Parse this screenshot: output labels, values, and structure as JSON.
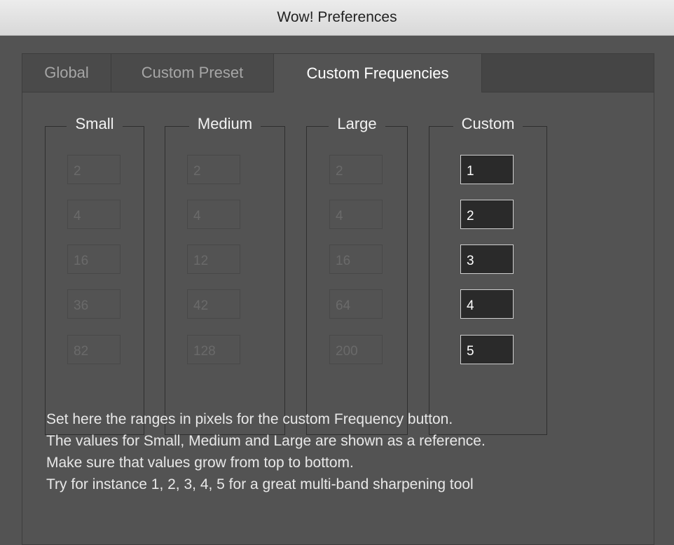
{
  "window": {
    "title": "Wow! Preferences"
  },
  "tabs": [
    {
      "label": "Global"
    },
    {
      "label": "Custom Preset"
    },
    {
      "label": "Custom Frequencies"
    }
  ],
  "groups": {
    "small": {
      "label": "Small",
      "values": [
        "2",
        "4",
        "16",
        "36",
        "82"
      ]
    },
    "medium": {
      "label": "Medium",
      "values": [
        "2",
        "4",
        "12",
        "42",
        "128"
      ]
    },
    "large": {
      "label": "Large",
      "values": [
        "2",
        "4",
        "16",
        "64",
        "200"
      ]
    },
    "custom": {
      "label": "Custom",
      "values": [
        "1",
        "2",
        "3",
        "4",
        "5"
      ]
    }
  },
  "help": {
    "lines": [
      "Set here the ranges in pixels for the custom Frequency button.",
      "The values for Small, Medium and Large are shown as a reference.",
      "Make sure that values grow from top to bottom.",
      "Try for instance 1, 2, 3, 4, 5 for a great multi-band sharpening tool"
    ]
  }
}
